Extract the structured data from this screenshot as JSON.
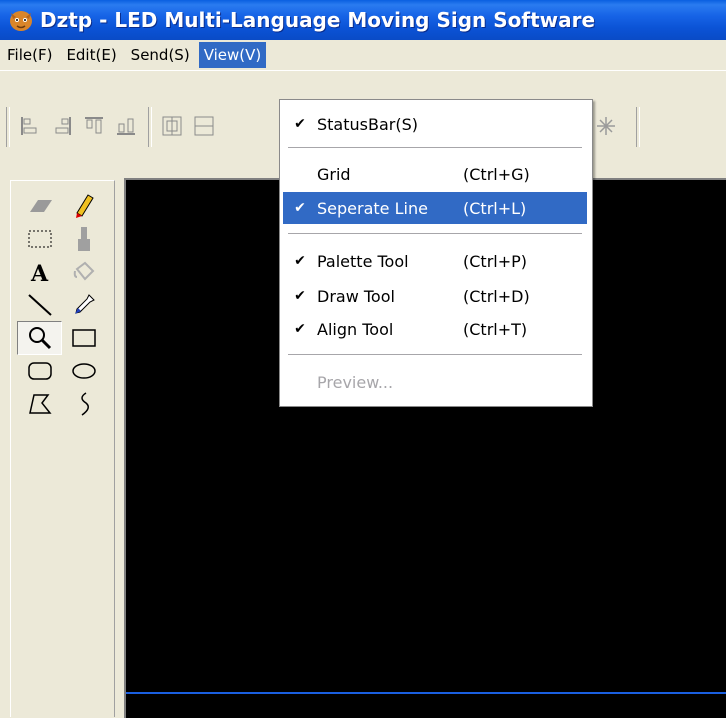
{
  "window": {
    "title": "Dztp - LED Multi-Language Moving Sign Software",
    "icon": "dztp-app-icon"
  },
  "menubar": [
    {
      "label": "File(F)"
    },
    {
      "label": "Edit(E)"
    },
    {
      "label": "Send(S)"
    },
    {
      "label": "View(V)",
      "active": true
    }
  ],
  "toolbar": {
    "icons": [
      "align-left-icon",
      "align-right-icon",
      "align-top-icon",
      "align-bottom-icon",
      "center-horizontal-icon",
      "center-vertical-icon",
      "sparkle-icon"
    ]
  },
  "palette": {
    "tools": [
      {
        "name": "eraser-icon"
      },
      {
        "name": "pencil-icon"
      },
      {
        "name": "select-rect-icon"
      },
      {
        "name": "brush-icon"
      },
      {
        "name": "text-icon"
      },
      {
        "name": "fill-bucket-icon"
      },
      {
        "name": "line-icon"
      },
      {
        "name": "eyedropper-icon"
      },
      {
        "name": "zoom-icon",
        "pressed": true
      },
      {
        "name": "rectangle-icon"
      },
      {
        "name": "rounded-rect-icon"
      },
      {
        "name": "ellipse-icon"
      },
      {
        "name": "polygon-icon"
      },
      {
        "name": "curve-icon"
      }
    ]
  },
  "view_menu": {
    "items": [
      {
        "label": "StatusBar(S)",
        "shortcut": "",
        "checked": true
      },
      {
        "label": "Grid",
        "shortcut": "(Ctrl+G)",
        "checked": false
      },
      {
        "label": "Seperate Line",
        "shortcut": "(Ctrl+L)",
        "checked": true,
        "highlighted": true
      },
      {
        "label": "Palette Tool",
        "shortcut": "(Ctrl+P)",
        "checked": true
      },
      {
        "label": "Draw Tool",
        "shortcut": "(Ctrl+D)",
        "checked": true
      },
      {
        "label": "Align Tool",
        "shortcut": "(Ctrl+T)",
        "checked": true
      },
      {
        "label": "Preview...",
        "shortcut": "",
        "checked": false,
        "disabled": true
      }
    ],
    "check_glyph": "✔"
  },
  "colors": {
    "title_bar": "#0A53D6",
    "menu_highlight": "#316AC5",
    "canvas": "#000000",
    "separate_line": "#1A5FE0",
    "face": "#ECE9D8"
  }
}
